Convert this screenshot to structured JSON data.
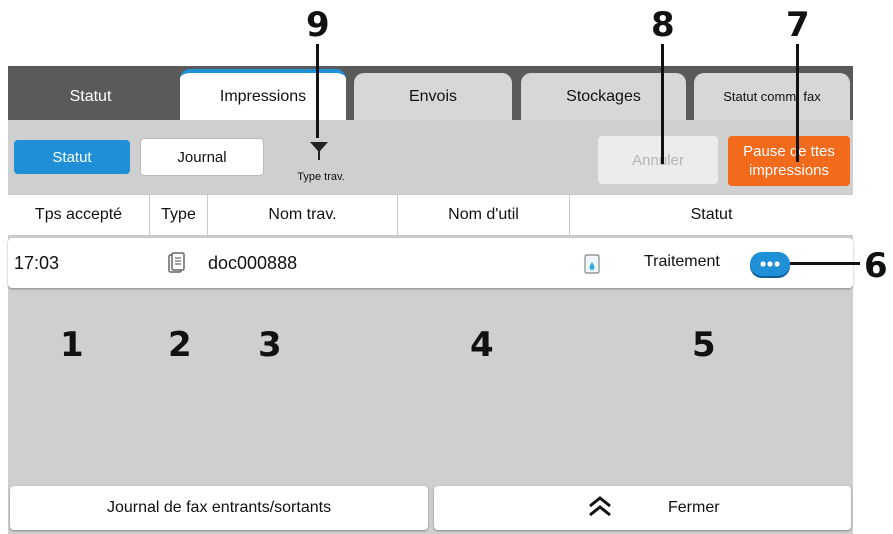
{
  "tabs": [
    {
      "label": "Statut"
    },
    {
      "label": "Impressions"
    },
    {
      "label": "Envois"
    },
    {
      "label": "Stockages"
    },
    {
      "label": "Statut comm. fax"
    }
  ],
  "toolbar": {
    "statut_label": "Statut",
    "journal_label": "Journal",
    "filter_label": "Type trav.",
    "cancel_label": "Annuler",
    "pause_label": "Pause de ttes impressions"
  },
  "table": {
    "columns": [
      "Tps accepté",
      "Type",
      "Nom trav.",
      "Nom d'util",
      "Statut"
    ],
    "rows": [
      {
        "time": "17:03",
        "name": "doc000888",
        "user": "",
        "status": "Traitement"
      }
    ]
  },
  "footer": {
    "fax_log_label": "Journal de fax entrants/sortants",
    "close_label": "Fermer"
  },
  "callouts": [
    "1",
    "2",
    "3",
    "4",
    "5",
    "6",
    "7",
    "8",
    "9"
  ],
  "colors": {
    "accent_blue": "#1f8fd8",
    "pause_orange": "#f26a1b",
    "tabbar_dark": "#5a5a5a",
    "panel_gray": "#cfcfcf"
  },
  "icons": {
    "filter": "funnel-icon",
    "job_type": "document-stack-icon",
    "status": "print-status-icon",
    "more": "more-options-icon",
    "close": "chevron-up-icon"
  }
}
